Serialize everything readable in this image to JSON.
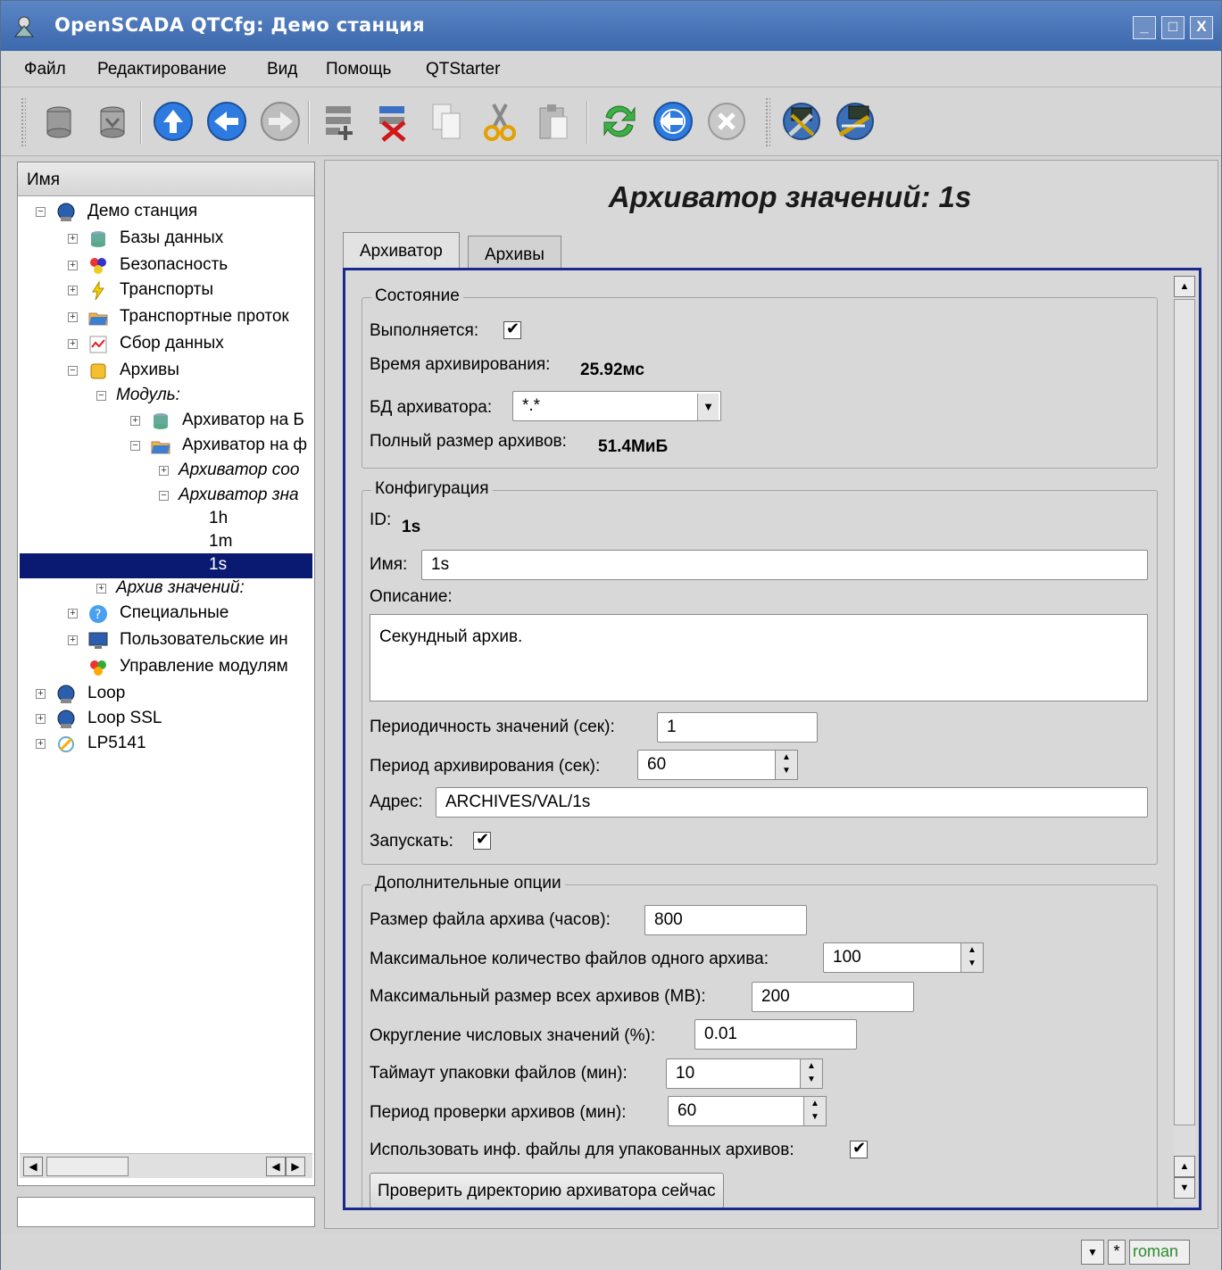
{
  "window": {
    "title": "OpenSCADA QTCfg: Демо станция",
    "controls": [
      "_",
      "□",
      "X"
    ]
  },
  "menu": [
    "Файл",
    "Редактирование",
    "Вид",
    "Помощь",
    "QTStarter"
  ],
  "toolbar": {
    "icons": [
      "db-load-icon",
      "db-save-icon",
      "up-icon",
      "back-icon",
      "forward-icon",
      "add-item-icon",
      "delete-item-icon",
      "copy-icon",
      "cut-icon",
      "paste-icon",
      "refresh-icon",
      "start-icon",
      "stop-icon",
      "config-tool-icon",
      "network-tool-icon"
    ]
  },
  "tree": {
    "header": "Имя",
    "nodes": [
      {
        "label": "Демо станция",
        "italic": false
      },
      {
        "label": "Базы данных",
        "italic": false
      },
      {
        "label": "Безопасность",
        "italic": false
      },
      {
        "label": "Транспорты",
        "italic": false
      },
      {
        "label": "Транспортные проток",
        "italic": false
      },
      {
        "label": "Сбор данных",
        "italic": false
      },
      {
        "label": "Архивы",
        "italic": false
      },
      {
        "label": "Модуль:",
        "italic": true
      },
      {
        "label": "Архиватор на Б",
        "italic": false
      },
      {
        "label": "Архиватор на ф",
        "italic": false
      },
      {
        "label": "Архиватор соо",
        "italic": true
      },
      {
        "label": "Архиватор зна",
        "italic": true
      },
      {
        "label": "1h",
        "italic": false
      },
      {
        "label": "1m",
        "italic": false
      },
      {
        "label": "1s",
        "italic": false
      },
      {
        "label": "Архив значений:",
        "italic": true
      },
      {
        "label": "Специальные",
        "italic": false
      },
      {
        "label": "Пользовательские ин",
        "italic": false
      },
      {
        "label": "Управление модулям",
        "italic": false
      },
      {
        "label": "Loop",
        "italic": false
      },
      {
        "label": "Loop SSL",
        "italic": false
      },
      {
        "label": "LP5141",
        "italic": false
      }
    ]
  },
  "page": {
    "title": "Архиватор значений: 1s",
    "tabs": [
      "Архиватор",
      "Архивы"
    ],
    "state": {
      "legend": "Состояние",
      "running_label": "Выполняется:",
      "running": true,
      "archive_time_label": "Время архивирования:",
      "archive_time": "25.92мс",
      "db_label": "БД архиватора:",
      "db_value": "*.*",
      "total_size_label": "Полный размер архивов:",
      "total_size": "51.4МиБ"
    },
    "config": {
      "legend": "Конфигурация",
      "id_label": "ID:",
      "id": "1s",
      "name_label": "Имя:",
      "name": "1s",
      "descr_label": "Описание:",
      "descr": "Секундный архив.",
      "period_label": "Периодичность значений (сек):",
      "period": "1",
      "arch_period_label": "Период архивирования (сек):",
      "arch_period": "60",
      "addr_label": "Адрес:",
      "addr": "ARCHIVES/VAL/1s",
      "start_label": "Запускать:",
      "start": true
    },
    "extra": {
      "legend": "Дополнительные опции",
      "file_size_label": "Размер файла архива (часов):",
      "file_size": "800",
      "max_files_label": "Максимальное количество файлов одного архива:",
      "max_files": "100",
      "max_size_label": "Максимальный размер всех архивов (MB):",
      "max_size": "200",
      "round_label": "Округление числовых значений (%):",
      "round": "0.01",
      "pack_timeout_label": "Таймаут упаковки файлов (мин):",
      "pack_timeout": "10",
      "check_period_label": "Период проверки архивов (мин):",
      "check_period": "60",
      "use_info_label": "Использовать инф. файлы для упакованных архивов:",
      "use_info": true,
      "check_now_button": "Проверить директорию архиватора сейчас"
    }
  },
  "status": {
    "modified": "*",
    "user": "roman",
    "user_color": "#2e8b2e"
  }
}
